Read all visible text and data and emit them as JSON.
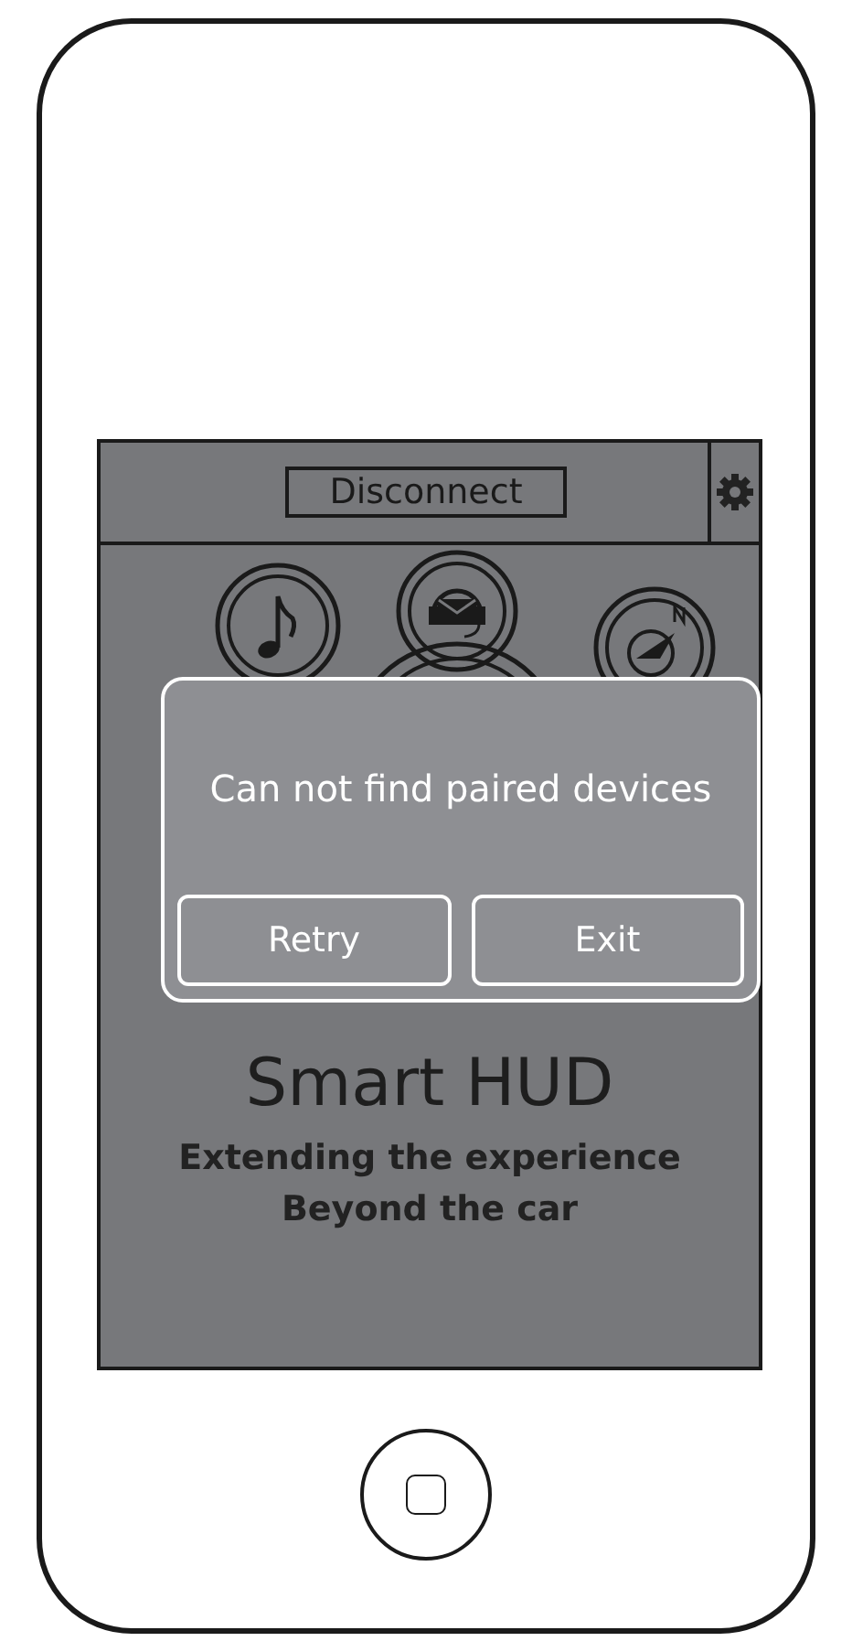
{
  "header": {
    "button": "Disconnect"
  },
  "dialog": {
    "message": "Can not find paired devices",
    "buttons": [
      {
        "label": "Retry"
      },
      {
        "label": "Exit"
      }
    ]
  },
  "app_title": "Smart HUD",
  "tagline": [
    "Extending the experience",
    "Beyond the car"
  ]
}
